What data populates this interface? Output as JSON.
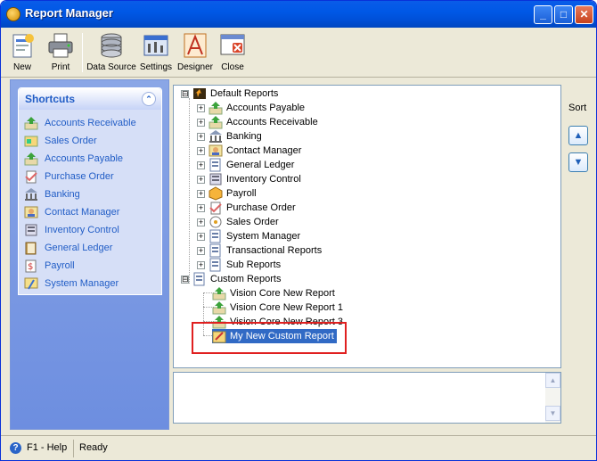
{
  "window": {
    "title": "Report Manager"
  },
  "titlebar_buttons": {
    "minimize": "_",
    "maximize": "□",
    "close": "✕"
  },
  "toolbar": [
    {
      "label": "New",
      "icon": "new-report-icon"
    },
    {
      "label": "Print",
      "icon": "printer-icon"
    },
    {
      "label": "Data Source",
      "icon": "database-icon"
    },
    {
      "label": "Settings",
      "icon": "settings-icon"
    },
    {
      "label": "Designer",
      "icon": "designer-icon"
    },
    {
      "label": "Close",
      "icon": "close-window-icon"
    }
  ],
  "shortcuts": {
    "title": "Shortcuts",
    "collapse_glyph": "⌃",
    "items": [
      {
        "label": "Accounts Receivable",
        "icon": "accounts-receivable-icon"
      },
      {
        "label": "Sales Order",
        "icon": "sales-order-icon"
      },
      {
        "label": "Accounts Payable",
        "icon": "accounts-payable-icon"
      },
      {
        "label": "Purchase Order",
        "icon": "purchase-order-icon"
      },
      {
        "label": "Banking",
        "icon": "banking-icon"
      },
      {
        "label": "Contact Manager",
        "icon": "contact-manager-icon"
      },
      {
        "label": "Inventory Control",
        "icon": "inventory-control-icon"
      },
      {
        "label": "General Ledger",
        "icon": "general-ledger-icon"
      },
      {
        "label": "Payroll",
        "icon": "payroll-icon"
      },
      {
        "label": "System Manager",
        "icon": "system-manager-icon"
      }
    ]
  },
  "tree": {
    "default_reports": {
      "label": "Default Reports",
      "expander": "⊟",
      "children": [
        "Accounts Payable",
        "Accounts Receivable",
        "Banking",
        "Contact Manager",
        "General Ledger",
        "Inventory Control",
        "Payroll",
        "Purchase Order",
        "Sales Order",
        "System Manager",
        "Transactional Reports",
        "Sub Reports"
      ]
    },
    "custom_reports": {
      "label": "Custom Reports",
      "expander": "⊟",
      "children": [
        "Vision Core New Report",
        "Vision Core New Report 1",
        "Vision Core New Report 3",
        "My New Custom Report"
      ],
      "highlighted": "My New Custom Report"
    }
  },
  "sort": {
    "label": "Sort",
    "up_glyph": "▲",
    "down_glyph": "▼"
  },
  "scroll": {
    "up_glyph": "▲",
    "down_glyph": "▼"
  },
  "status": {
    "help_glyph": "?",
    "help": "F1 - Help",
    "state": "Ready"
  },
  "colors": {
    "title_blue": "#0054e3",
    "panel_blue": "#6d8ee0",
    "link_blue": "#215dc6",
    "highlight_red": "#e02020"
  }
}
